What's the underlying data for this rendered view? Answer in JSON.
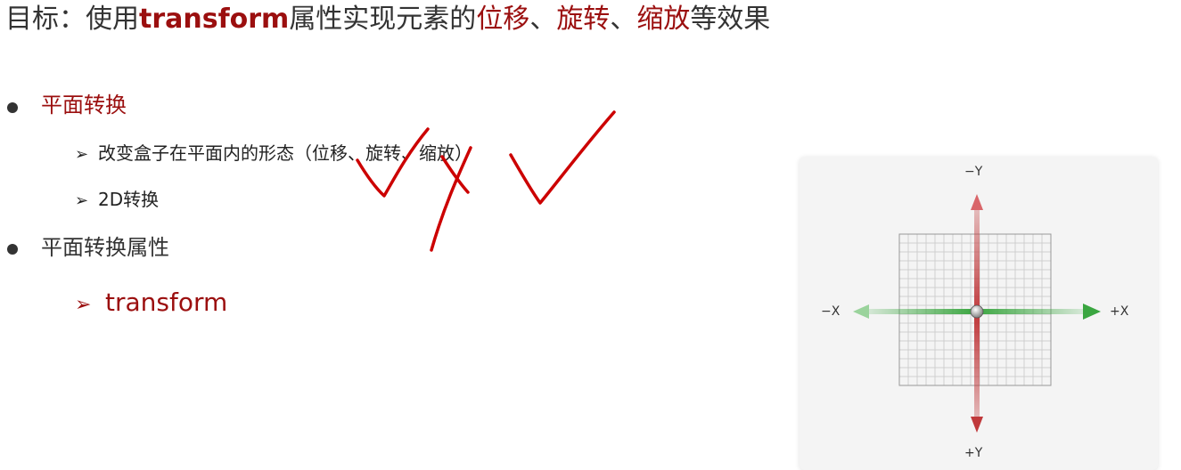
{
  "title": {
    "prefix": "目标：使用",
    "keyword": "transform",
    "middle": "属性实现元素的",
    "translate": "位移",
    "sep1": "、",
    "rotate": "旋转",
    "sep2": "、",
    "scale": "缩放",
    "suffix": "等效果"
  },
  "list": {
    "item1": "平面转换",
    "item1_subs": [
      "改变盒子在平面内的形态（位移、旋转、缩放）",
      "2D转换"
    ],
    "item2": "平面转换属性",
    "item2_subs": [
      "transform"
    ],
    "sub_marker": "➢"
  },
  "diagram": {
    "neg_y": "−Y",
    "pos_y": "+Y",
    "neg_x": "−X",
    "pos_x": "+X"
  },
  "colors": {
    "accent": "#9b0f0f",
    "y_axis": "#c0393b",
    "x_axis": "#3aa640",
    "ink": "#cc0000"
  }
}
